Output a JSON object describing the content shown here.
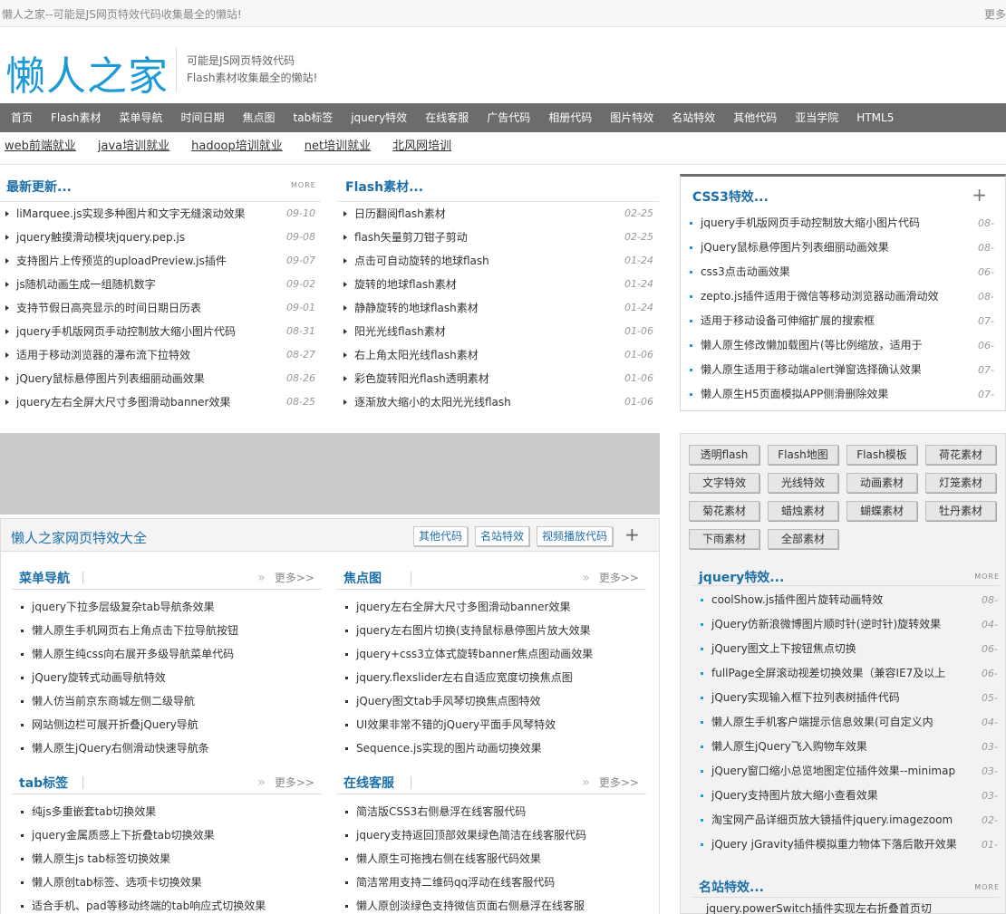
{
  "topbar": {
    "tagline": "懒人之家--可能是JS网页特效代码收集最全的懒站!",
    "more": "更多"
  },
  "header": {
    "logo": "懒人之家",
    "slogan_line1": "可能是JS网页特效代码",
    "slogan_line2": "Flash素材收集最全的懒站!"
  },
  "nav": [
    "首页",
    "Flash素材",
    "菜单导航",
    "时间日期",
    "焦点图",
    "tab标签",
    "jquery特效",
    "在线客服",
    "广告代码",
    "相册代码",
    "图片特效",
    "名站特效",
    "其他代码",
    "亚当学院",
    "HTML5"
  ],
  "subnav": [
    "web前端就业",
    "java培训就业",
    "hadoop培训就业",
    "net培训就业",
    "北风网培训"
  ],
  "latest": {
    "title": "最新更新...",
    "more": "MORE",
    "items": [
      {
        "t": "liMarquee.js实现多种图片和文字无缝滚动效果",
        "d": "09-10"
      },
      {
        "t": "jquery触摸滑动模块jquery.pep.js",
        "d": "09-08"
      },
      {
        "t": "支持图片上传预览的uploadPreview.js插件",
        "d": "09-07"
      },
      {
        "t": "js随机动画生成一组随机数字",
        "d": "09-02"
      },
      {
        "t": "支持节假日高亮显示的时间日期日历表",
        "d": "09-01"
      },
      {
        "t": "jquery手机版网页手动控制放大缩小图片代码",
        "d": "08-31"
      },
      {
        "t": "适用于移动浏览器的瀑布流下拉特效",
        "d": "08-27"
      },
      {
        "t": "jQuery鼠标悬停图片列表细丽动画效果",
        "d": "08-26"
      },
      {
        "t": "jquery左右全屏大尺寸多图滑动banner效果",
        "d": "08-25"
      }
    ]
  },
  "flash": {
    "title": "Flash素材...",
    "items": [
      {
        "t": "日历翻阅flash素材",
        "d": "02-25"
      },
      {
        "t": "flash矢量剪刀钳子剪动",
        "d": "02-25"
      },
      {
        "t": "点击可自动旋转的地球flash",
        "d": "01-24"
      },
      {
        "t": "旋转的地球flash素材",
        "d": "01-24"
      },
      {
        "t": "静静旋转的地球flash素材",
        "d": "01-24"
      },
      {
        "t": "阳光光线flash素材",
        "d": "01-06"
      },
      {
        "t": "右上角太阳光线flash素材",
        "d": "01-06"
      },
      {
        "t": "彩色旋转阳光flash透明素材",
        "d": "01-06"
      },
      {
        "t": "逐渐放大缩小的太阳光光线flash",
        "d": "01-06"
      }
    ]
  },
  "css3": {
    "title": "CSS3特效...",
    "plus": "+",
    "items": [
      {
        "t": "jquery手机版网页手动控制放大缩小图片代码",
        "d": "08-"
      },
      {
        "t": "jQuery鼠标悬停图片列表细丽动画效果",
        "d": "08-"
      },
      {
        "t": "css3点击动画效果",
        "d": "06-"
      },
      {
        "t": "zepto.js插件适用于微信等移动浏览器动画滑动效",
        "d": "08-"
      },
      {
        "t": "适用于移动设备可伸缩扩展的搜索框",
        "d": "07-"
      },
      {
        "t": "懒人原生修改懒加载图片(等比例缩放，适用于",
        "d": "06-"
      },
      {
        "t": "懒人原生适用于移动端alert弹窗选择确认效果",
        "d": "07-"
      },
      {
        "t": "懒人原生H5页面模拟APP侧滑删除效果",
        "d": "07-"
      }
    ]
  },
  "fx": {
    "title": "懒人之家网页特效大全",
    "tabs": [
      "其他代码",
      "名站特效",
      "视频播放代码"
    ],
    "plus": "+",
    "more": "更多>>",
    "menu": {
      "title": "菜单导航",
      "items": [
        "jquery下拉多层级复杂tab导航条效果",
        "懒人原生手机网页右上角点击下拉导航按钮",
        "懒人原生纯css向右展开多级导航菜单代码",
        "jQuery旋转式动画导航特效",
        "懒人仿当前京东商城左侧二级导航",
        "网站侧边栏可展开折叠jQuery导航",
        "懒人原生jQuery右侧滑动快速导航条"
      ]
    },
    "focus": {
      "title": "焦点图",
      "items": [
        "jquery左右全屏大尺寸多图滑动banner效果",
        "jquery左右图片切换(支持鼠标悬停图片放大效果",
        "jquery+css3立体式旋转banner焦点图动画效果",
        "jquery.flexslider左右自适应宽度切换焦点图",
        "jQuery图文tab手风琴切换焦点图特效",
        "UI效果非常不错的jQuery平面手风琴特效",
        "Sequence.js实现的图片动画切换效果"
      ]
    },
    "tab": {
      "title": "tab标签",
      "items": [
        "纯js多重嵌套tab切换效果",
        "jquery金属质感上下折叠tab切换效果",
        "懒人原生js tab标签切换效果",
        "懒人原创tab标签、选项卡切换效果",
        "适合手机、pad等移动终端的tab响应式切换效果"
      ]
    },
    "service": {
      "title": "在线客服",
      "items": [
        "简洁版CSS3右侧悬浮在线客服代码",
        "jquery支持返回顶部效果绿色简洁在线客服代码",
        "懒人原生可拖拽右侧在线客服代码效果",
        "简洁常用支持二维码qq浮动在线客服代码",
        "懒人原创淡绿色支持微信页面右侧悬浮在线客服"
      ]
    }
  },
  "tags": [
    "透明flash",
    "Flash地图",
    "Flash模板",
    "荷花素材",
    "文字特效",
    "光线特效",
    "动画素材",
    "灯笼素材",
    "菊花素材",
    "蜡烛素材",
    "蝴蝶素材",
    "牡丹素材",
    "下雨素材",
    "全部素材"
  ],
  "jquery": {
    "title": "jquery特效...",
    "more": "MORE",
    "items": [
      {
        "t": "coolShow.js插件图片旋转动画特效",
        "d": "08-"
      },
      {
        "t": "jQuery仿新浪微博图片顺时针(逆时针)旋转效果",
        "d": "04-"
      },
      {
        "t": "jQuery图文上下按钮焦点切换",
        "d": "06-"
      },
      {
        "t": "fullPage全屏滚动视差切换效果（兼容IE7及以上",
        "d": "06-"
      },
      {
        "t": "jQuery实现输入框下拉列表树插件代码",
        "d": "05-"
      },
      {
        "t": "懒人原生手机客户端提示信息效果(可自定义内",
        "d": "04-"
      },
      {
        "t": "懒人原生jQuery飞入购物车效果",
        "d": "03-"
      },
      {
        "t": "jQuery窗口缩小总览地图定位插件效果--minimap",
        "d": "03-"
      },
      {
        "t": "jQuery支持图片放大缩小查看效果",
        "d": "03-"
      },
      {
        "t": "淘宝网产品详细页放大镜插件jquery.imagezoom",
        "d": "02-"
      },
      {
        "t": "jQuery jGravity插件模拟重力物体下落后散开效果",
        "d": "01-"
      }
    ]
  },
  "mingzhan": {
    "title": "名站特效...",
    "more": "MORE",
    "items": [
      "jquery.powerSwitch插件实现左右折叠首页切"
    ]
  }
}
